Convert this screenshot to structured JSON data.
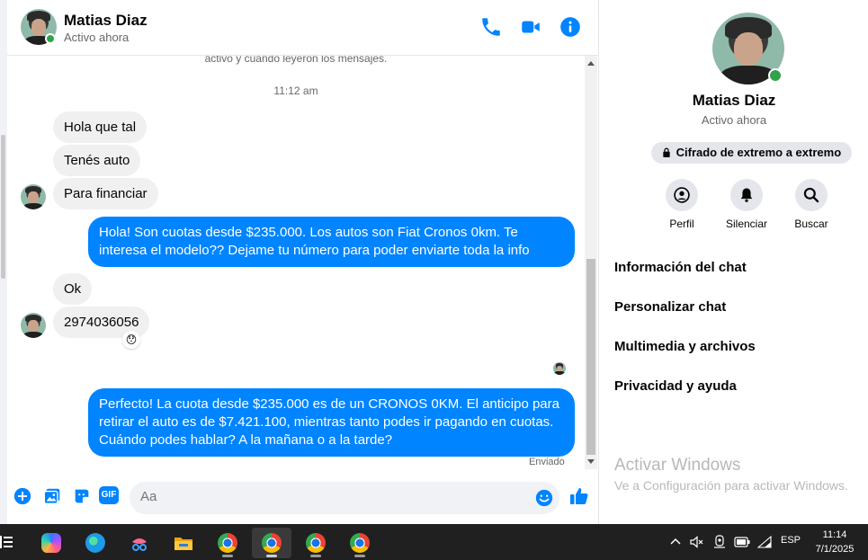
{
  "header": {
    "name": "Matias Diaz",
    "status": "Activo ahora"
  },
  "messages": {
    "top_note": "activo y cuándo leyeron los mensajes.",
    "timestamp": "11:12 am",
    "incoming_1": "Hola que tal",
    "incoming_2": "Tenés auto",
    "incoming_3": "Para financiar",
    "outgoing_1": "Hola! Son cuotas desde $235.000. Los autos son Fiat Cronos 0km. Te interesa el modelo?? Dejame tu número para poder enviarte toda la info",
    "incoming_4": "Ok",
    "incoming_5": "2974036056",
    "reaction": "😯",
    "outgoing_2": "Perfecto! La cuota desde $235.000 es de un CRONOS 0KM. El anticipo para retirar el auto es de $7.421.100, mientras tanto podes ir pagando en cuotas. Cuándo podes hablar? A la mañana o a la tarde?",
    "status": "Enviado"
  },
  "composer": {
    "placeholder": "Aa",
    "gif_label": "GIF"
  },
  "info_panel": {
    "name": "Matias Diaz",
    "status": "Activo ahora",
    "encryption": "Cifrado de extremo a extremo",
    "actions": [
      "Perfil",
      "Silenciar",
      "Buscar"
    ],
    "menu": [
      "Información del chat",
      "Personalizar chat",
      "Multimedia y archivos",
      "Privacidad y ayuda"
    ]
  },
  "watermark": {
    "title": "Activar Windows",
    "subtitle": "Ve a Configuración para activar Windows."
  },
  "taskbar": {
    "language": "ESP",
    "time": "11:14",
    "date": "7/1/2025"
  },
  "colors": {
    "accent": "#0084ff",
    "online": "#31a24c"
  }
}
